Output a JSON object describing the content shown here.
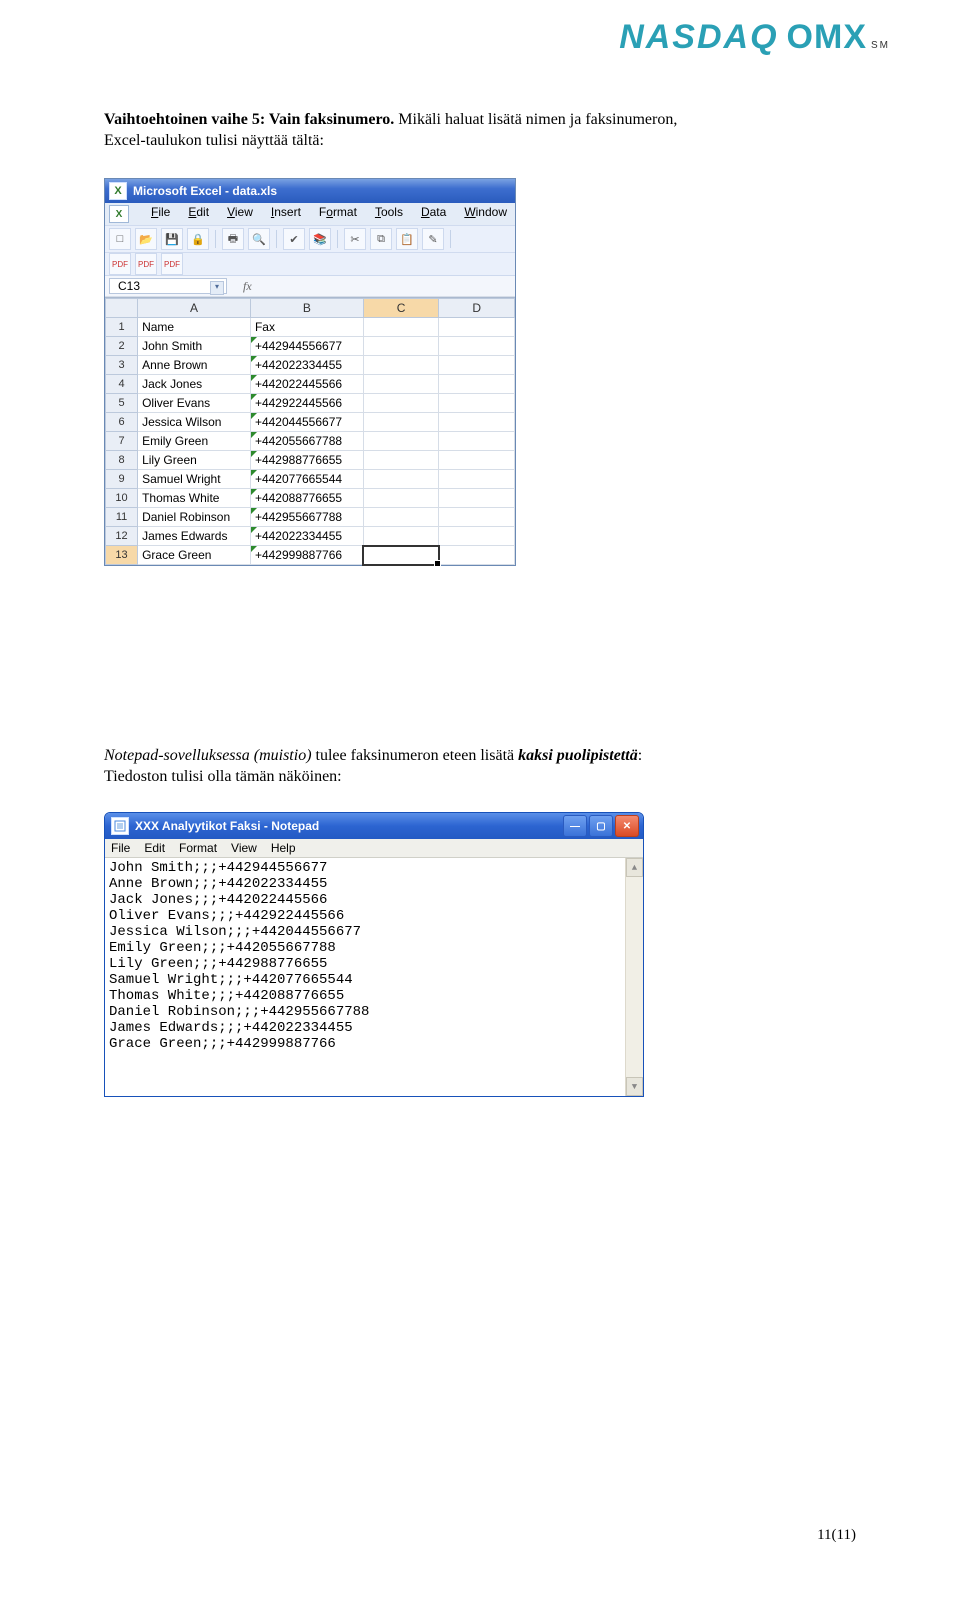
{
  "logo": {
    "nasdaq": "NASDAQ",
    "omx": "OMX",
    "sm": "SM"
  },
  "doc": {
    "heading": "Vaihtoehtoinen vaihe 5: Vain faksinumero.",
    "line2a": "Mikäli haluat lisätä nimen ja faksinumeron,",
    "line2b": "Excel-taulukon tulisi näyttää tältä:",
    "para2_pre": "Notepad-sovelluksessa (muistio)",
    "para2_mid": " tulee faksinumeron eteen lisätä ",
    "para2_bold": "kaksi puolipistettä",
    "para2_colon": ":",
    "para2_line2": "Tiedoston tulisi olla tämän näköinen:",
    "page_number": "11(11)"
  },
  "excel": {
    "title": "Microsoft Excel - data.xls",
    "menu": [
      "File",
      "Edit",
      "View",
      "Insert",
      "Format",
      "Tools",
      "Data",
      "Window"
    ],
    "namebox": "C13",
    "fx_label": "fx",
    "toolbar2": [
      "PDF",
      "PDF",
      "PDF"
    ],
    "columns": [
      "",
      "A",
      "B",
      "C",
      "D"
    ],
    "rows": [
      {
        "n": "1",
        "A": "Name",
        "B": "Fax",
        "C": "",
        "D": ""
      },
      {
        "n": "2",
        "A": "John Smith",
        "B": "+442944556677",
        "C": "",
        "D": ""
      },
      {
        "n": "3",
        "A": "Anne Brown",
        "B": "+442022334455",
        "C": "",
        "D": ""
      },
      {
        "n": "4",
        "A": "Jack Jones",
        "B": "+442022445566",
        "C": "",
        "D": ""
      },
      {
        "n": "5",
        "A": "Oliver Evans",
        "B": "+442922445566",
        "C": "",
        "D": ""
      },
      {
        "n": "6",
        "A": "Jessica Wilson",
        "B": "+442044556677",
        "C": "",
        "D": ""
      },
      {
        "n": "7",
        "A": "Emily Green",
        "B": "+442055667788",
        "C": "",
        "D": ""
      },
      {
        "n": "8",
        "A": "Lily Green",
        "B": "+442988776655",
        "C": "",
        "D": ""
      },
      {
        "n": "9",
        "A": "Samuel Wright",
        "B": "+442077665544",
        "C": "",
        "D": ""
      },
      {
        "n": "10",
        "A": "Thomas White",
        "B": "+442088776655",
        "C": "",
        "D": ""
      },
      {
        "n": "11",
        "A": "Daniel Robinson",
        "B": "+442955667788",
        "C": "",
        "D": ""
      },
      {
        "n": "12",
        "A": "James Edwards",
        "B": "+442022334455",
        "C": "",
        "D": ""
      },
      {
        "n": "13",
        "A": "Grace Green",
        "B": "+442999887766",
        "C": "",
        "D": ""
      }
    ]
  },
  "notepad": {
    "title": "XXX Analyytikot Faksi - Notepad",
    "menu": [
      "File",
      "Edit",
      "Format",
      "View",
      "Help"
    ],
    "lines": [
      "John Smith;;;+442944556677",
      "Anne Brown;;;+442022334455",
      "Jack Jones;;;+442022445566",
      "Oliver Evans;;;+442922445566",
      "Jessica Wilson;;;+442044556677",
      "Emily Green;;;+442055667788",
      "Lily Green;;;+442988776655",
      "Samuel Wright;;;+442077665544",
      "Thomas White;;;+442088776655",
      "Daniel Robinson;;;+442955667788",
      "James Edwards;;;+442022334455",
      "Grace Green;;;+442999887766"
    ]
  }
}
